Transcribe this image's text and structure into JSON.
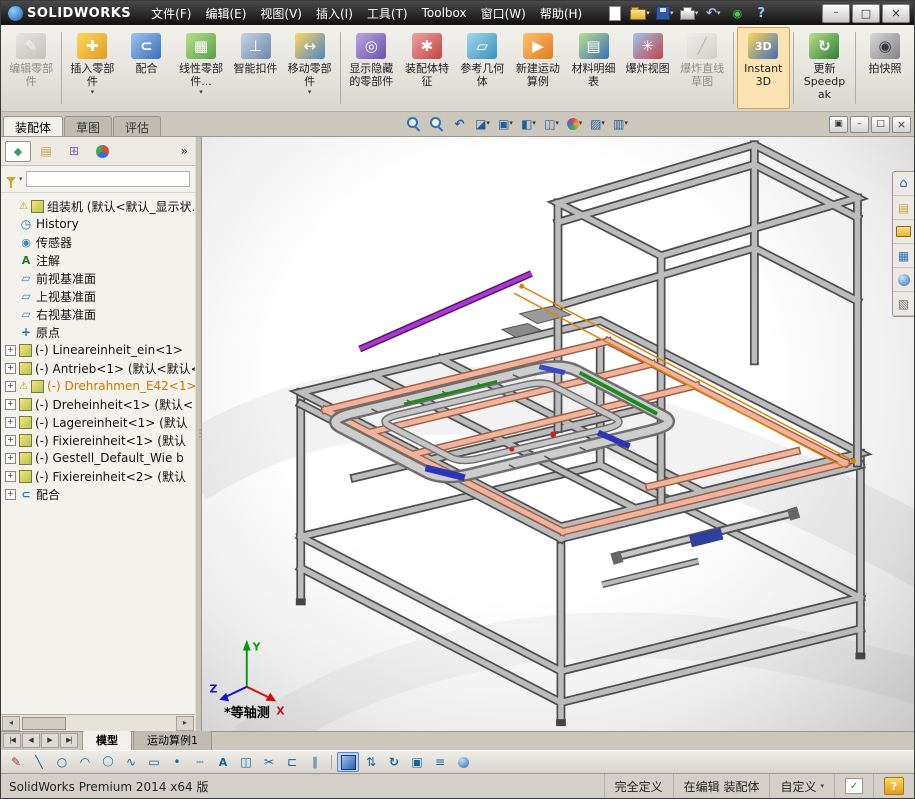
{
  "titlebar": {
    "logo": "SOLIDWORKS",
    "menus": [
      "文件(F)",
      "编辑(E)",
      "视图(V)",
      "插入(I)",
      "工具(T)",
      "Toolbox",
      "窗口(W)",
      "帮助(H)"
    ],
    "quick_tools": [
      {
        "icon": "new-doc"
      },
      {
        "icon": "open",
        "caret": "has-caret"
      },
      {
        "icon": "save",
        "caret": "has-caret"
      },
      {
        "icon": "print",
        "caret": "has-caret"
      },
      {
        "icon": "undo",
        "caret": "has-caret"
      },
      {
        "icon": "rebuild"
      },
      {
        "icon": "help-question"
      }
    ],
    "window_controls": [
      {
        "icon": "minimize"
      },
      {
        "icon": "maximize"
      },
      {
        "icon": "close"
      }
    ]
  },
  "ribbon": {
    "buttons": [
      {
        "label": "编辑零部件",
        "icon": "edit-component",
        "state": "disabled"
      },
      {
        "state": "sep"
      },
      {
        "label": "插入零部件",
        "icon": "insert-component",
        "caret": "has-caret"
      },
      {
        "label": "配合",
        "icon": "mate"
      },
      {
        "label": "线性零部件...",
        "icon": "linear-pattern",
        "caret": "has-caret"
      },
      {
        "label": "智能扣件",
        "icon": "smart-fasteners"
      },
      {
        "label": "移动零部件",
        "icon": "move-component",
        "caret": "has-caret"
      },
      {
        "state": "sep"
      },
      {
        "label": "显示隐藏的零部件",
        "icon": "show-hidden-components"
      },
      {
        "label": "装配体特征",
        "icon": "assembly-features"
      },
      {
        "label": "参考几何体",
        "icon": "reference-geometry"
      },
      {
        "label": "新建运动算例",
        "icon": "new-motion-study"
      },
      {
        "label": "材料明细表",
        "icon": "bill-of-materials"
      },
      {
        "label": "爆炸视图",
        "icon": "exploded-view"
      },
      {
        "label": "爆炸直线草图",
        "icon": "explode-line-sketch",
        "state": "disabled"
      },
      {
        "state": "sep"
      },
      {
        "label": "Instant3D",
        "icon": "instant3d",
        "state": "active"
      },
      {
        "state": "sep"
      },
      {
        "label": "更新 Speedpak",
        "icon": "update-speedpak"
      },
      {
        "state": "sep"
      },
      {
        "label": "拍快照",
        "icon": "take-snapshot"
      }
    ]
  },
  "cmdtabs": [
    {
      "label": "装配体",
      "state": "active"
    },
    {
      "label": "草图"
    },
    {
      "label": "评估"
    }
  ],
  "panel": {
    "fm_tabs": [
      {
        "icon": "featuremanager",
        "state": "active"
      },
      {
        "icon": "propertymanager"
      },
      {
        "icon": "configurationmanager"
      },
      {
        "icon": "displaymanager"
      }
    ],
    "more": "»"
  },
  "tree": {
    "items": [
      {
        "label": "组装机 (默认<默认_显示状...",
        "icon": "assembly-root",
        "warn": "warn"
      },
      {
        "label": "History",
        "icon": "history"
      },
      {
        "label": "传感器",
        "icon": "sensors"
      },
      {
        "label": "注解",
        "icon": "annotations"
      },
      {
        "label": "前视基准面",
        "icon": "plane"
      },
      {
        "label": "上视基准面",
        "icon": "plane"
      },
      {
        "label": "右视基准面",
        "icon": "plane"
      },
      {
        "label": "原点",
        "icon": "origin"
      },
      {
        "label": "(-) Lineareinheit_ein<1>",
        "icon": "component",
        "exp": "exp"
      },
      {
        "label": "(-) Antrieb<1> (默认<默认<",
        "icon": "component",
        "exp": "exp"
      },
      {
        "label": "(-) Drehrahmen_E42<1>",
        "icon": "component",
        "exp": "exp",
        "warn": "warn",
        "mod": "editing"
      },
      {
        "label": "(-) Dreheinheit<1> (默认<",
        "icon": "component",
        "exp": "exp"
      },
      {
        "label": "(-) Lagereinheit<1> (默认",
        "icon": "component",
        "exp": "exp"
      },
      {
        "label": "(-) Fixiereinheit<1> (默认",
        "icon": "component",
        "exp": "exp"
      },
      {
        "label": "(-) Gestell_Default_Wie b",
        "icon": "component",
        "exp": "exp"
      },
      {
        "label": "(-) Fixiereinheit<2> (默认",
        "icon": "component",
        "exp": "exp"
      },
      {
        "label": "配合",
        "icon": "mates",
        "exp": "exp"
      }
    ]
  },
  "viewport": {
    "headsup": [
      {
        "icon": "zoom-fit"
      },
      {
        "icon": "zoom-area"
      },
      {
        "icon": "previous-view"
      },
      {
        "icon": "section-view",
        "caret": "has-caret"
      },
      {
        "icon": "view-orientation",
        "caret": "has-caret"
      },
      {
        "icon": "display-style",
        "caret": "has-caret"
      },
      {
        "icon": "hide-show-items",
        "caret": "has-caret"
      },
      {
        "icon": "edit-appearance",
        "caret": "has-caret"
      },
      {
        "icon": "apply-scene",
        "caret": "has-caret"
      },
      {
        "icon": "view-settings",
        "caret": "has-caret"
      }
    ],
    "mdi_controls": [
      {
        "icon": "mdi-windows"
      },
      {
        "icon": "mdi-minimize"
      },
      {
        "icon": "mdi-restore"
      },
      {
        "icon": "mdi-close"
      }
    ],
    "taskpane": [
      {
        "icon": "resources"
      },
      {
        "icon": "design-library"
      },
      {
        "icon": "file-explorer"
      },
      {
        "icon": "view-palette"
      },
      {
        "icon": "appearances"
      },
      {
        "icon": "custom-properties"
      }
    ],
    "view_label": "*等轴测",
    "triad": {
      "x": "X",
      "y": "Y",
      "z": "Z"
    }
  },
  "modeltabs": {
    "nav": [
      {
        "icon": "tab-first"
      },
      {
        "icon": "tab-prev"
      },
      {
        "icon": "tab-next"
      },
      {
        "icon": "tab-last"
      }
    ],
    "tabs": [
      {
        "label": "模型",
        "state": "active"
      },
      {
        "label": "运动算例1"
      }
    ]
  },
  "sketchbar": {
    "items": [
      {
        "icon": "sketch"
      },
      {
        "icon": "line"
      },
      {
        "icon": "circle"
      },
      {
        "icon": "arc"
      },
      {
        "icon": "ellipse"
      },
      {
        "icon": "spline"
      },
      {
        "icon": "rectangle"
      },
      {
        "icon": "point"
      },
      {
        "icon": "centerline"
      },
      {
        "icon": "text-tool"
      },
      {
        "icon": "mirror"
      },
      {
        "icon": "trim"
      },
      {
        "icon": "convert-entities"
      },
      {
        "icon": "offset"
      },
      {
        "state": "sep"
      },
      {
        "icon": "display-style-shaded",
        "state": "active"
      },
      {
        "icon": "vertical-dims"
      },
      {
        "icon": "rotate-view"
      },
      {
        "icon": "edit-sketch"
      },
      {
        "icon": "layers"
      },
      {
        "icon": "motion"
      }
    ]
  },
  "statusbar": {
    "product": "SolidWorks Premium 2014 x64 版",
    "cells": [
      {
        "label": "完全定义"
      },
      {
        "label": "在编辑 装配体"
      },
      {
        "label": "自定义",
        "caret": "has-caret"
      }
    ]
  }
}
